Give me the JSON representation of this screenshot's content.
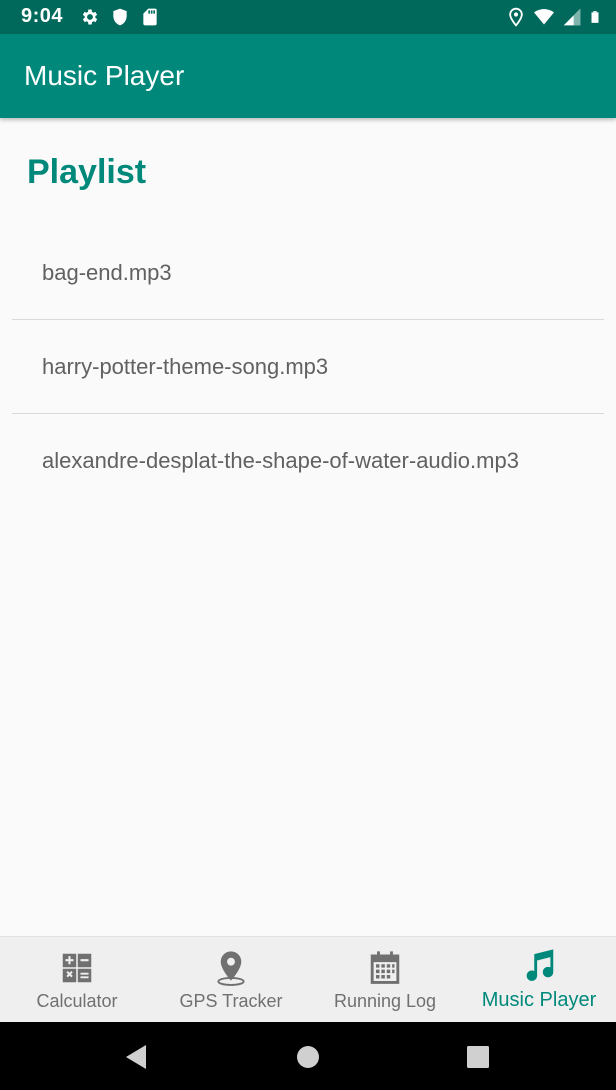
{
  "status_bar": {
    "time": "9:04",
    "left_icons": [
      "gear-icon",
      "shield-icon",
      "sd-card-icon"
    ],
    "right_icons": [
      "location-icon",
      "wifi-icon",
      "signal-icon",
      "battery-icon"
    ]
  },
  "app_bar": {
    "title": "Music Player"
  },
  "content": {
    "heading": "Playlist",
    "tracks": [
      {
        "name": "bag-end.mp3"
      },
      {
        "name": "harry-potter-theme-song.mp3"
      },
      {
        "name": "alexandre-desplat-the-shape-of-water-audio.mp3"
      }
    ]
  },
  "bottom_nav": {
    "items": [
      {
        "label": "Calculator",
        "icon": "calculator-icon",
        "active": false
      },
      {
        "label": "GPS Tracker",
        "icon": "location-pin-icon",
        "active": false
      },
      {
        "label": "Running Log",
        "icon": "calendar-icon",
        "active": false
      },
      {
        "label": "Music Player",
        "icon": "music-note-icon",
        "active": true
      }
    ]
  },
  "colors": {
    "status_bar": "#00695c",
    "app_bar": "#00897b",
    "accent": "#00897b",
    "background": "#fafafa",
    "nav_background": "#efefef"
  },
  "system_nav": {
    "buttons": [
      "back-icon",
      "home-icon",
      "recents-icon"
    ]
  }
}
